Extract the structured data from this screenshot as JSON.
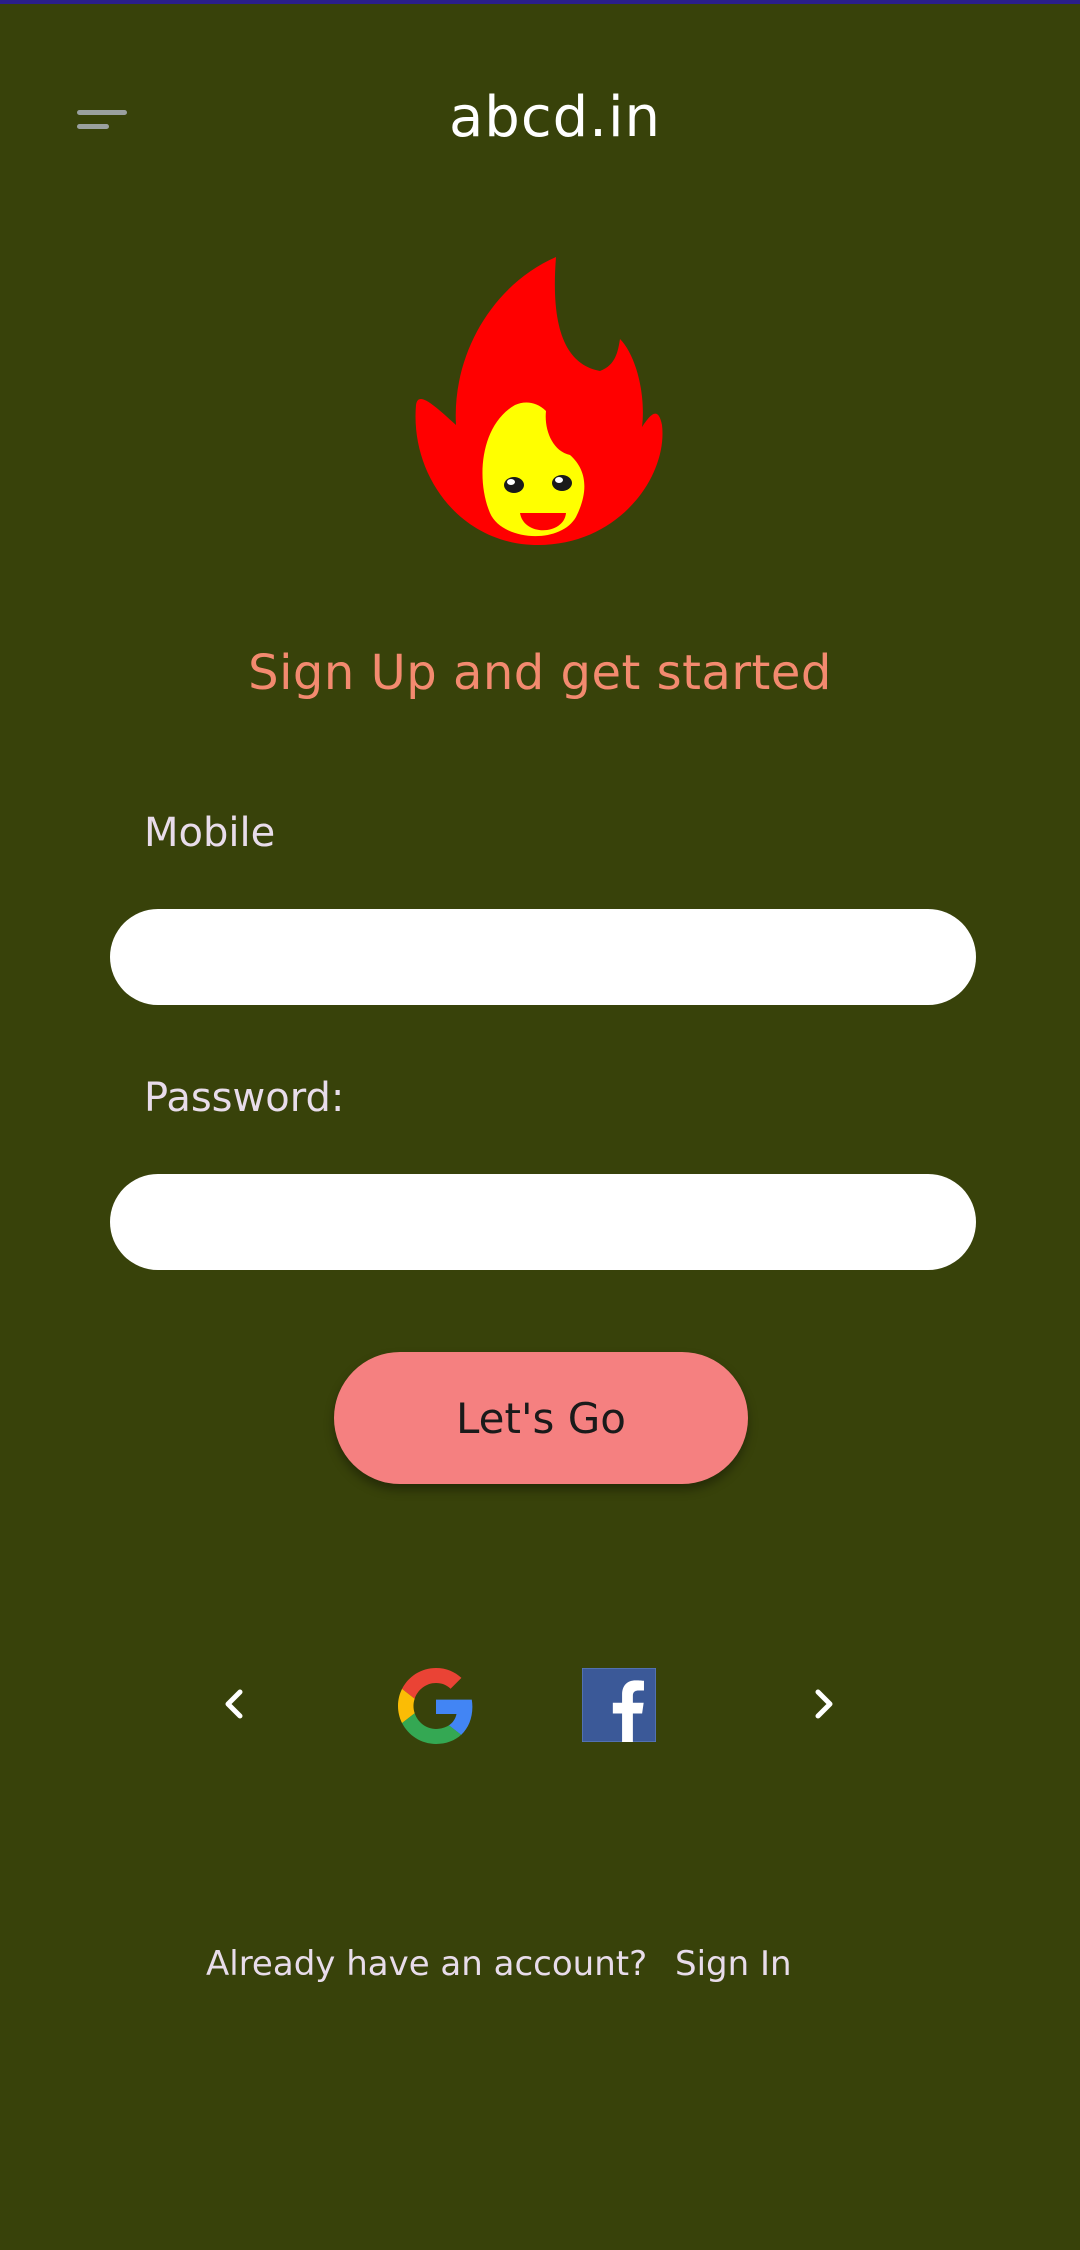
{
  "header": {
    "menu_icon": "hamburger-menu-icon",
    "title": "abcd.in"
  },
  "logo": {
    "icon": "fire-mascot-logo",
    "flame_color": "#ff0000",
    "face_color": "#ffff00"
  },
  "headline": "Sign Up and get started",
  "form": {
    "mobile_label": "Mobile",
    "mobile_value": "",
    "password_label": "Password:",
    "password_value": "",
    "submit_label": "Let's Go"
  },
  "social": {
    "prev_icon": "chevron-left-icon",
    "next_icon": "chevron-right-icon",
    "providers": [
      "google-icon",
      "facebook-icon"
    ]
  },
  "footer": {
    "prompt": "Already have an account?",
    "link": "Sign In"
  },
  "colors": {
    "background": "#38420a",
    "accent": "#f58080",
    "headline": "#f38a6f"
  }
}
